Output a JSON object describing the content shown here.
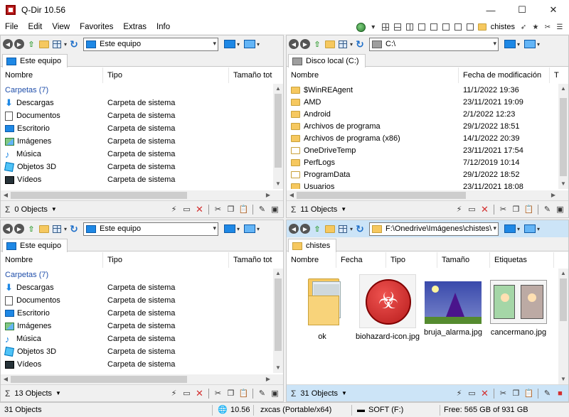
{
  "window": {
    "title": "Q-Dir 10.56",
    "minimize": "—",
    "maximize": "☐",
    "close": "✕"
  },
  "menu": {
    "items": [
      "File",
      "Edit",
      "View",
      "Favorites",
      "Extras",
      "Info"
    ],
    "favorite_label": "chistes"
  },
  "panes": {
    "top_left": {
      "address": "Este equipo",
      "tab": "Este equipo",
      "columns": [
        "Nombre",
        "Tipo",
        "Tamaño tot"
      ],
      "group": "Carpetas (7)",
      "rows": [
        {
          "name": "Descargas",
          "type": "Carpeta de sistema"
        },
        {
          "name": "Documentos",
          "type": "Carpeta de sistema"
        },
        {
          "name": "Escritorio",
          "type": "Carpeta de sistema"
        },
        {
          "name": "Imágenes",
          "type": "Carpeta de sistema"
        },
        {
          "name": "Música",
          "type": "Carpeta de sistema"
        },
        {
          "name": "Objetos 3D",
          "type": "Carpeta de sistema"
        },
        {
          "name": "Vídeos",
          "type": "Carpeta de sistema"
        }
      ],
      "status": "0 Objects"
    },
    "top_right": {
      "address": "C:\\",
      "tab": "Disco local (C:)",
      "columns": [
        "Nombre",
        "Fecha de modificación",
        "T"
      ],
      "rows": [
        {
          "name": "$WinREAgent",
          "date": "11/1/2022 19:36"
        },
        {
          "name": "AMD",
          "date": "23/11/2021 19:09"
        },
        {
          "name": "Android",
          "date": "2/1/2022 12:23"
        },
        {
          "name": "Archivos de programa",
          "date": "29/1/2022 18:51"
        },
        {
          "name": "Archivos de programa (x86)",
          "date": "14/1/2022 20:39"
        },
        {
          "name": "OneDriveTemp",
          "date": "23/11/2021 17:54"
        },
        {
          "name": "PerfLogs",
          "date": "7/12/2019 10:14"
        },
        {
          "name": "ProgramData",
          "date": "29/1/2022 18:52"
        },
        {
          "name": "Usuarios",
          "date": "23/11/2021 18:08"
        }
      ],
      "status": "11 Objects"
    },
    "bottom_left": {
      "address": "Este equipo",
      "tab": "Este equipo",
      "columns": [
        "Nombre",
        "Tipo",
        "Tamaño tot"
      ],
      "group": "Carpetas (7)",
      "rows": [
        {
          "name": "Descargas",
          "type": "Carpeta de sistema"
        },
        {
          "name": "Documentos",
          "type": "Carpeta de sistema"
        },
        {
          "name": "Escritorio",
          "type": "Carpeta de sistema"
        },
        {
          "name": "Imágenes",
          "type": "Carpeta de sistema"
        },
        {
          "name": "Música",
          "type": "Carpeta de sistema"
        },
        {
          "name": "Objetos 3D",
          "type": "Carpeta de sistema"
        },
        {
          "name": "Vídeos",
          "type": "Carpeta de sistema"
        }
      ],
      "status": "13 Objects"
    },
    "bottom_right": {
      "address": "F:\\Onedrive\\Imágenes\\chistes\\",
      "tab": "chistes",
      "columns": [
        "Nombre",
        "Fecha",
        "Tipo",
        "Tamaño",
        "Etiquetas"
      ],
      "thumbnails": [
        {
          "label": "ok"
        },
        {
          "label": "biohazard-icon.jpg"
        },
        {
          "label": "bruja_alarma.jpg"
        },
        {
          "label": "cancermano.jpg"
        }
      ],
      "status": "31 Objects"
    }
  },
  "app_status": {
    "objects": "31 Objects",
    "version": "10.56",
    "edition": "zxcas (Portable/x64)",
    "drive": "SOFT (F:)",
    "free": "Free: 565 GB of 931 GB"
  },
  "colors": {
    "active_pane": "#cce4f7",
    "group_text": "#1f4eaa",
    "folder": "#f6c85f"
  }
}
